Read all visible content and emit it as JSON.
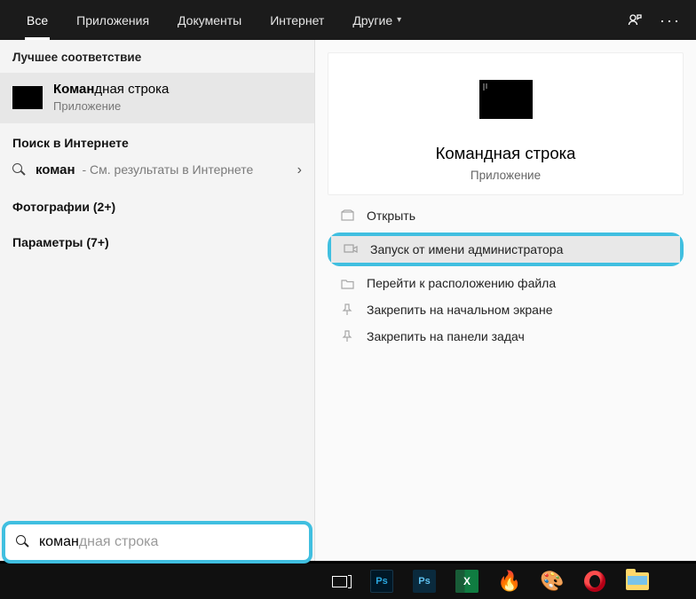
{
  "tabs": {
    "all": "Все",
    "apps": "Приложения",
    "documents": "Документы",
    "internet": "Интернет",
    "other": "Другие"
  },
  "left": {
    "best_match_header": "Лучшее соответствие",
    "best_match": {
      "title_bold": "Коман",
      "title_rest": "дная строка",
      "subtitle": "Приложение"
    },
    "internet_header": "Поиск в Интернете",
    "internet_row": {
      "query": "коман",
      "rest": " - См. результаты в Интернете"
    },
    "photos_header": "Фотографии (2+)",
    "params_header": "Параметры (7+)"
  },
  "right": {
    "title": "Командная строка",
    "subtitle": "Приложение",
    "actions": {
      "open": "Открыть",
      "run_admin": "Запуск от имени администратора",
      "open_location": "Перейти к расположению файла",
      "pin_start": "Закрепить на начальном экране",
      "pin_taskbar": "Закрепить на панели задач"
    }
  },
  "search": {
    "typed": "коман",
    "ghost": "дная строка"
  },
  "taskbar": {
    "ps1": "Ps",
    "ps2": "Ps",
    "xl": "X",
    "flame": "🔥",
    "palette": "🎨"
  }
}
